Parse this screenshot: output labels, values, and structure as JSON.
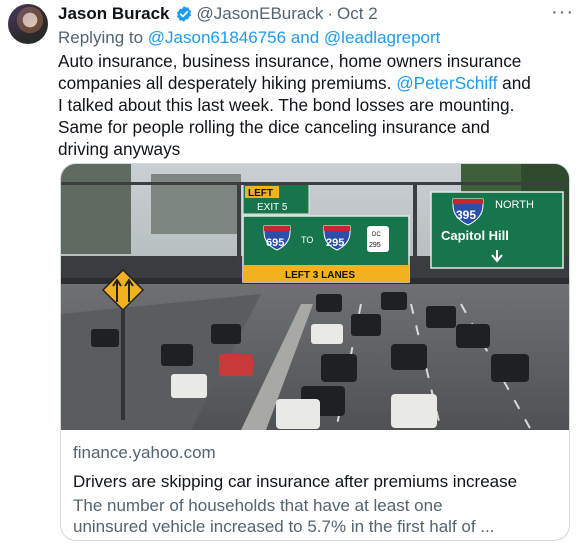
{
  "author": {
    "name": "Jason Burack",
    "handle": "@JasonEBurack",
    "separator": "·",
    "date": "Oct 2",
    "verified_icon": "verified-badge-icon",
    "more_label": "···"
  },
  "reply": {
    "prefix": "Replying to",
    "user1": "@Jason61846756",
    "and": "and",
    "user2": "@leadlagreport"
  },
  "tweet": {
    "line1": "Auto insurance, business insurance, home owners insurance",
    "line2a": "companies all desperately hiking premiums.",
    "line2_mention": "@PeterSchiff",
    "line2b": "and",
    "line3": "I talked about this last week. The bond losses are mounting.",
    "line4": "Same for people rolling the dice canceling insurance and",
    "line5": "driving anyways"
  },
  "card": {
    "domain": "finance.yahoo.com",
    "title": "Drivers are skipping car insurance after premiums increase",
    "desc_line1": "The number of households that have at least one",
    "desc_line2": "uninsured vehicle increased to 5.7% in the first half of ...",
    "image": {
      "sign_left": "LEFT",
      "sign_exit": "EXIT 5",
      "route1": "695",
      "to": "TO",
      "route2": "295",
      "route3": "295",
      "dc": "DC",
      "lanes": "LEFT 3 LANES",
      "route4": "395",
      "north": "NORTH",
      "destination": "Capitol Hill"
    }
  },
  "colors": {
    "accent": "#1d9bf0",
    "muted": "#536471",
    "sign_green": "#16754a",
    "sign_yellow": "#f2b21f"
  }
}
